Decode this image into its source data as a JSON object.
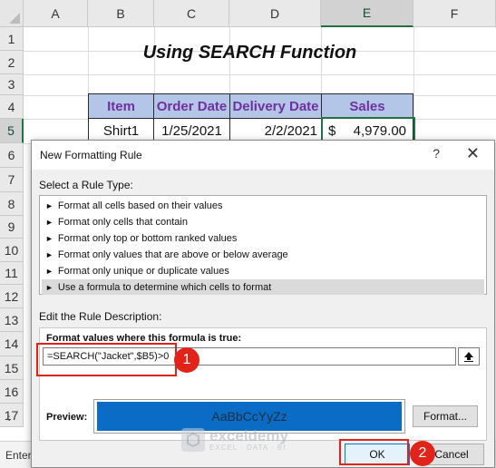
{
  "spreadsheet": {
    "columns": [
      "A",
      "B",
      "C",
      "D",
      "E",
      "F"
    ],
    "rows": [
      "1",
      "2",
      "3",
      "4",
      "5",
      "6",
      "7",
      "8",
      "9",
      "10",
      "11",
      "12",
      "13",
      "14",
      "15",
      "16",
      "17"
    ],
    "title": "Using SEARCH Function",
    "table": {
      "headers": [
        "Item",
        "Order Date",
        "Delivery Date",
        "Sales"
      ],
      "row": {
        "item": "Shirt1",
        "order_date": "1/25/2021",
        "delivery_date": "2/2/2021",
        "currency": "$",
        "sales": "4,979.00"
      }
    },
    "status_text": "Enter",
    "scroll_arrow": "‹"
  },
  "dialog": {
    "title": "New Formatting Rule",
    "help": "?",
    "close": "✕",
    "select_rule_label": "Select a Rule Type:",
    "rule_types": [
      "Format all cells based on their values",
      "Format only cells that contain",
      "Format only top or bottom ranked values",
      "Format only values that are above or below average",
      "Format only unique or duplicate values",
      "Use a formula to determine which cells to format"
    ],
    "selected_rule_index": 5,
    "edit_rule_label": "Edit the Rule Description:",
    "formula_label": "Format values where this formula is true:",
    "formula": "=SEARCH(\"Jacket\",$B5)>0",
    "preview_label": "Preview:",
    "preview_text": "AaBbCcYyZz",
    "format_button": "Format...",
    "ok_button": "OK",
    "cancel_button": "Cancel"
  },
  "annotations": {
    "step1": "1",
    "step2": "2"
  },
  "watermark": {
    "name": "exceldemy",
    "tagline": "EXCEL · DATA · BI"
  },
  "colors": {
    "header_fill": "#b4c6e7",
    "header_text": "#7030a0",
    "preview_fill": "#0a6cc4",
    "annotation_red": "#e2231a",
    "excel_green": "#217346"
  }
}
